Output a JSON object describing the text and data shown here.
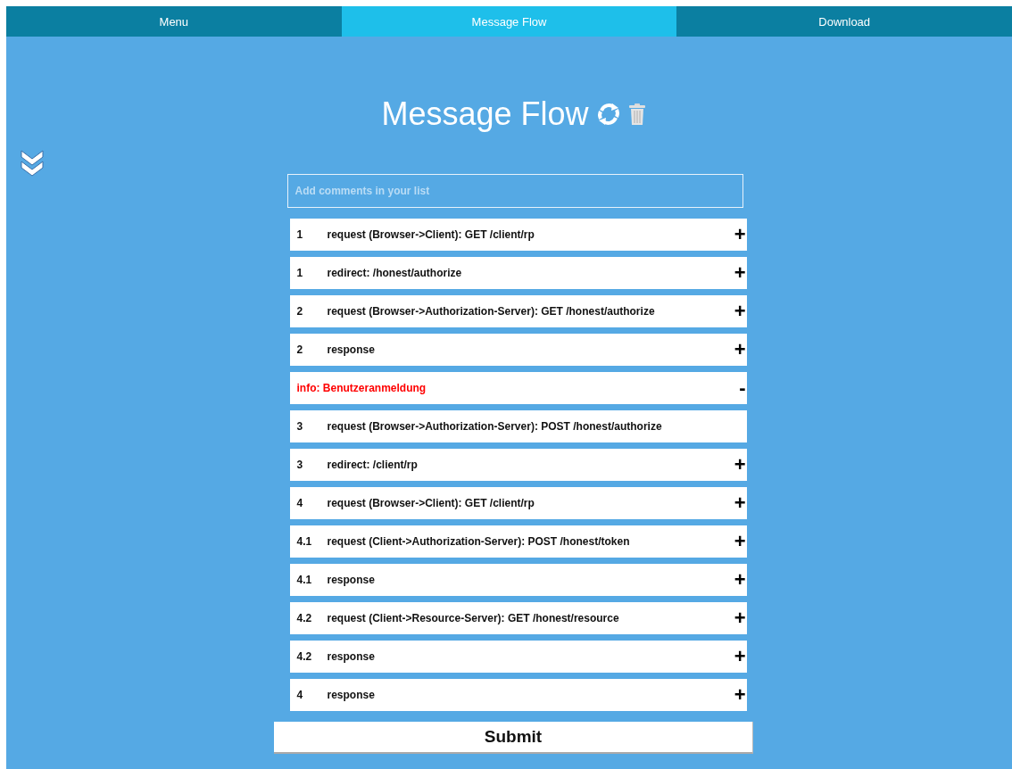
{
  "tabs": [
    {
      "label": "Menu",
      "selected": false
    },
    {
      "label": "Message Flow",
      "selected": true
    },
    {
      "label": "Download",
      "selected": false
    }
  ],
  "title": "Message Flow",
  "comment_field": {
    "placeholder": "Add comments in your list"
  },
  "messages": [
    {
      "kind": "message",
      "step": "1",
      "text": "request (Browser->Client): GET /client/rp",
      "toggle": "+"
    },
    {
      "kind": "message",
      "step": "1",
      "text": "redirect: /honest/authorize",
      "toggle": "+"
    },
    {
      "kind": "message",
      "step": "2",
      "text": "request (Browser->Authorization-Server): GET /honest/authorize",
      "toggle": "+"
    },
    {
      "kind": "message",
      "step": "2",
      "text": "response",
      "toggle": "+"
    },
    {
      "kind": "info",
      "text": "info: Benutzeranmeldung",
      "toggle": "-"
    },
    {
      "kind": "message",
      "step": "3",
      "text": "request (Browser->Authorization-Server): POST /honest/authorize"
    },
    {
      "kind": "message",
      "step": "3",
      "text": "redirect: /client/rp",
      "toggle": "+"
    },
    {
      "kind": "message",
      "step": "4",
      "text": "request (Browser->Client): GET /client/rp",
      "toggle": "+"
    },
    {
      "kind": "message",
      "step": "4.1",
      "text": "request (Client->Authorization-Server): POST /honest/token",
      "toggle": "+"
    },
    {
      "kind": "message",
      "step": "4.1",
      "text": "response",
      "toggle": "+"
    },
    {
      "kind": "message",
      "step": "4.2",
      "text": "request (Client->Resource-Server): GET /honest/resource",
      "toggle": "+"
    },
    {
      "kind": "message",
      "step": "4.2",
      "text": "response",
      "toggle": "+"
    },
    {
      "kind": "message",
      "step": "4",
      "text": "response",
      "toggle": "+"
    }
  ],
  "submit": "Submit"
}
